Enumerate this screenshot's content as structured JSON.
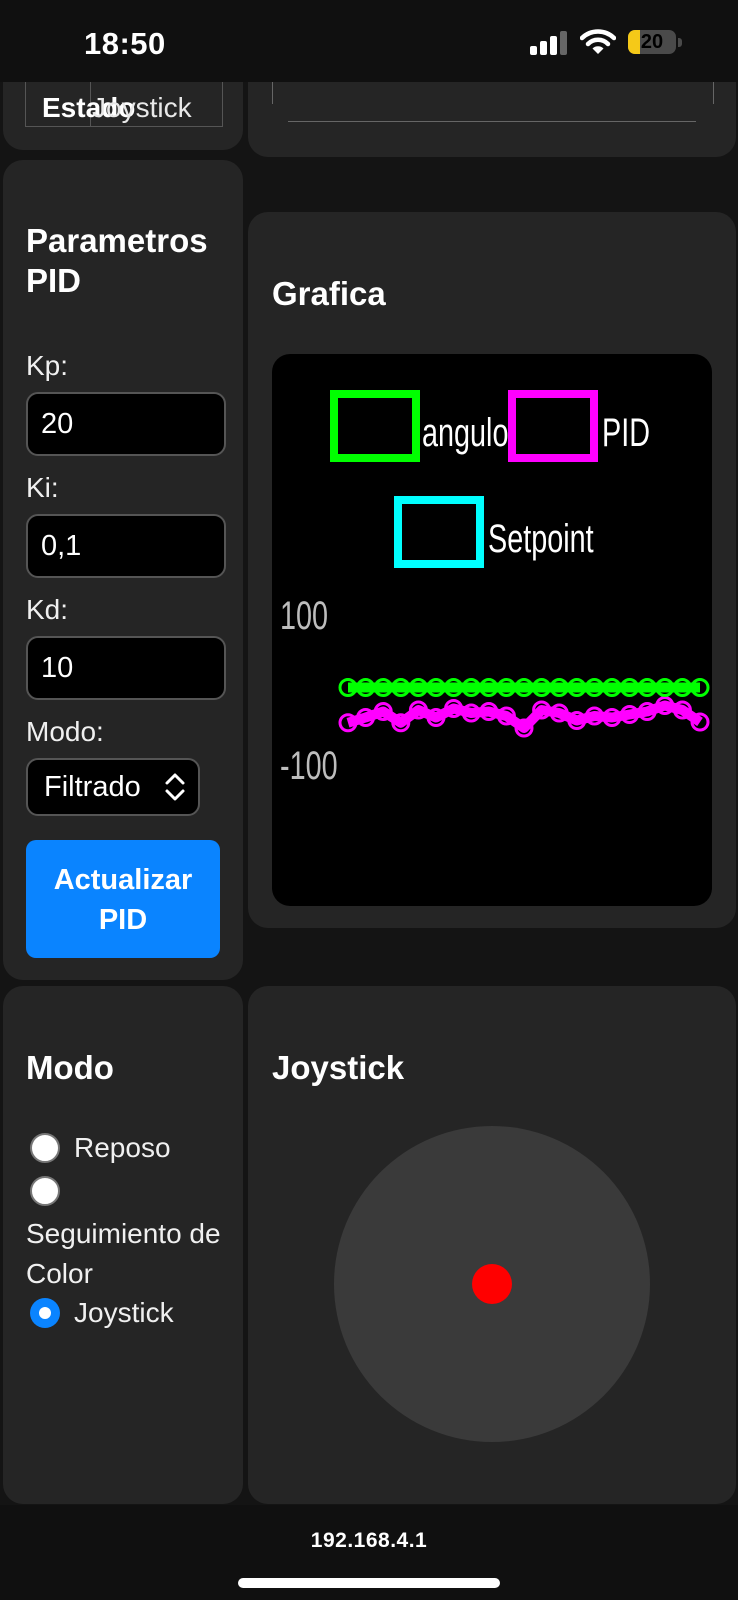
{
  "status_bar": {
    "time": "18:50",
    "battery": "20"
  },
  "top_cards": {
    "state_header": "Estado",
    "joystick_header": "Joystick"
  },
  "pid": {
    "title": "Parametros PID",
    "kp_label": "Kp:",
    "kp_value": "20",
    "ki_label": "Ki:",
    "ki_value": "0,1",
    "kd_label": "Kd:",
    "kd_value": "10",
    "mode_label": "Modo:",
    "mode_value": "Filtrado",
    "update_button": "Actualizar PID"
  },
  "graph": {
    "title": "Grafica",
    "colors": {
      "angulo": "#00ff00",
      "pid": "#ff00ff",
      "setpoint": "#00ffff"
    }
  },
  "chart_data": {
    "type": "line",
    "legend": [
      "angulo",
      "PID",
      "Setpoint"
    ],
    "y_tick_labels": [
      "100",
      "-100"
    ],
    "ylim": [
      -150,
      150
    ],
    "legend_position": "top",
    "series": [
      {
        "name": "angulo",
        "values": [
          2,
          2,
          2,
          2,
          2,
          2,
          2,
          2,
          2,
          2,
          2,
          2,
          2,
          2,
          2,
          2,
          2,
          2,
          2,
          2,
          2
        ]
      },
      {
        "name": "PID",
        "values": [
          -45,
          -38,
          -30,
          -45,
          -28,
          -38,
          -26,
          -32,
          -30,
          -36,
          -52,
          -28,
          -32,
          -42,
          -36,
          -38,
          -34,
          -30,
          -22,
          -28,
          -44
        ]
      },
      {
        "name": "Setpoint",
        "values": [
          0,
          0,
          0,
          0,
          0,
          0,
          0,
          0,
          0,
          0,
          0,
          0,
          0,
          0,
          0,
          0,
          0,
          0,
          0,
          0,
          0
        ]
      }
    ]
  },
  "mode_card": {
    "title": "Modo",
    "options": [
      {
        "label": "Reposo",
        "selected": false
      },
      {
        "label": "Seguimiento de Color",
        "selected": false
      },
      {
        "label": "Joystick",
        "selected": true
      }
    ]
  },
  "joystick_card": {
    "title": "Joystick"
  },
  "browser": {
    "url": "192.168.4.1"
  }
}
